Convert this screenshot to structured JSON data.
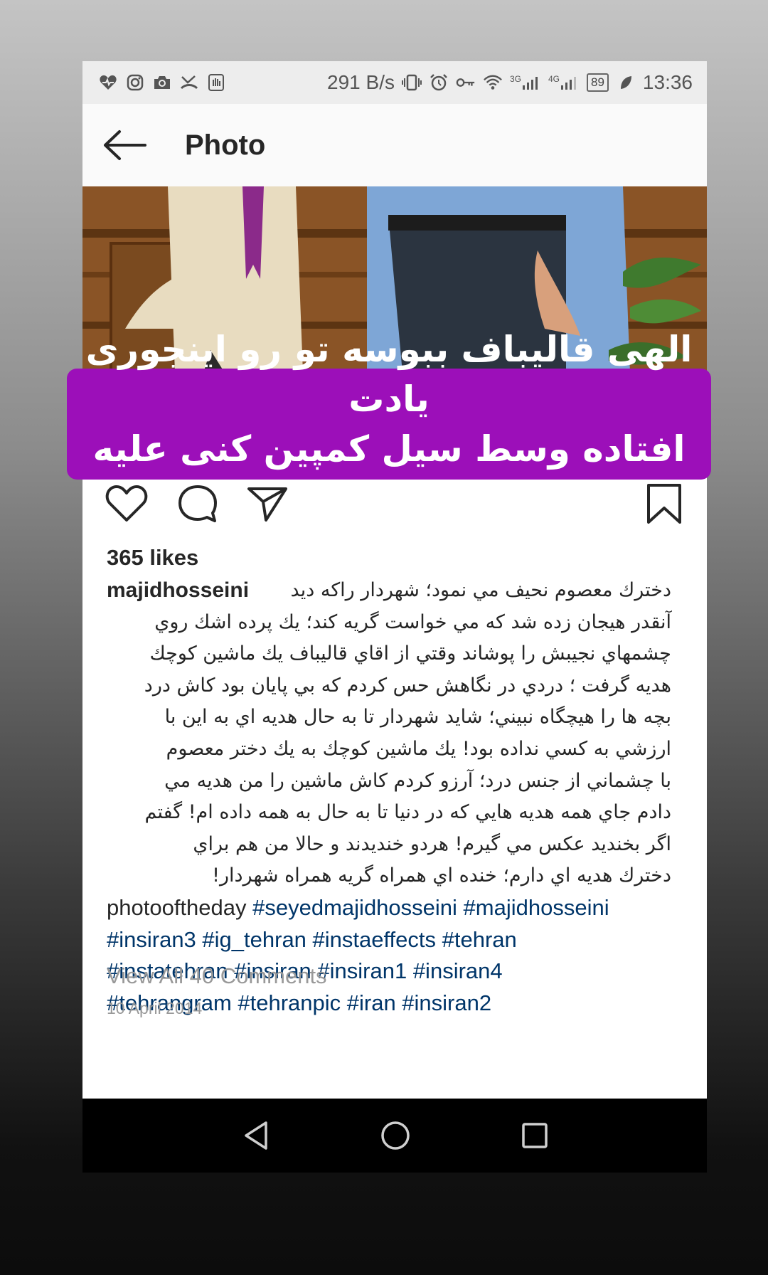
{
  "status_bar": {
    "network_speed": "291 B/s",
    "network_3g": "3G",
    "network_4g": "4G",
    "battery": "89",
    "time": "13:36",
    "left_icons": [
      "health-icon",
      "instagram-icon",
      "camera-icon",
      "missed-call-icon",
      "hand-icon"
    ],
    "right_icons": [
      "vibrate-icon",
      "alarm-icon",
      "key-icon",
      "wifi-icon",
      "signal-icon",
      "leaf-icon"
    ]
  },
  "header": {
    "title": "Photo",
    "back_icon": "arrow-left-icon"
  },
  "overlay_banner": {
    "line1": "الهی قالیباف ببوسه تو رو اینجوری یادت",
    "line2": "افتاده وسط سیل کمپین کنی علیه حسن",
    "background": "#9c0fb9"
  },
  "actions": {
    "like_icon": "heart-icon",
    "comment_icon": "comment-icon",
    "share_icon": "send-icon",
    "save_icon": "bookmark-icon"
  },
  "post": {
    "likes": "365 likes",
    "username": "majidhosseini",
    "caption_lines": [
      "دخترك معصوم نحيف مي نمود؛ شهردار راكه ديد",
      "آنقدر هيجان زده شد كه مي خواست گريه كند؛ يك پرده اشك روي",
      "چشمهاي نجيبش را پوشاند وقتي از اقاي قاليباف يك ماشين كوچك",
      "هديه گرفت ؛ دردي در نگاهش حس كردم كه بي پايان بود كاش درد",
      "بچه ها را هيچگاه نبيني؛ شايد شهردار تا به حال هديه اي به اين با",
      "ارزشي به كسي نداده بود! يك ماشين كوچك به يك دختر معصوم",
      "با چشماني از جنس درد؛ آرزو كردم كاش ماشين را من هديه مي",
      "دادم جاي همه هديه هايي كه در دنيا تا به حال به همه داده ام! گفتم",
      "اگر بخنديد عكس مي گيرم! هردو خنديدند و حالا من هم براي",
      "دخترك هديه اي دارم؛ خنده اي همراه گريه همراه شهردار!"
    ],
    "hashtag_line1_plain": "photooftheday",
    "hashtag_line1_tags": "#seyedmajidhosseini #majidhosseini",
    "hashtag_line2": "#insiran3 #ig_tehran #instaeffects #tehran",
    "hashtag_line3": "#instatehran #insiran #insiran1 #insiran4",
    "hashtag_line4": "#tehrangram #tehranpic #iran #insiran2",
    "view_comments": "View All 40 Comments",
    "date": "10 April 2014"
  },
  "nav_bar": {
    "back_icon": "nav-back-icon",
    "home_icon": "nav-home-icon",
    "recents_icon": "nav-recents-icon"
  }
}
